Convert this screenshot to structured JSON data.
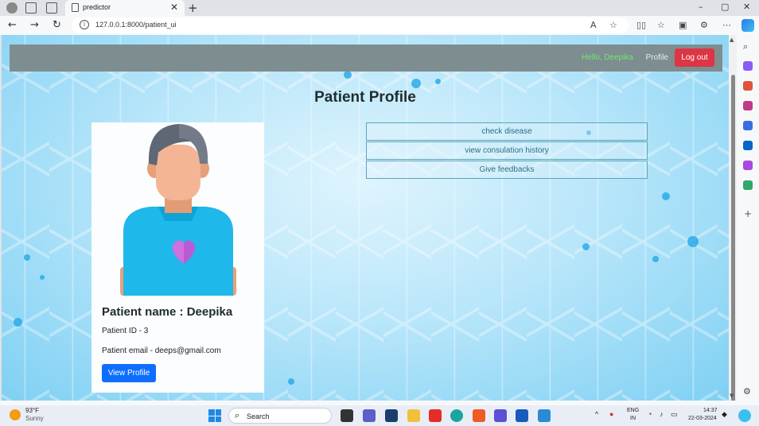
{
  "browser": {
    "tab_title": "predictor",
    "tab_close": "✕",
    "new_tab": "+",
    "url": "127.0.0.1:8000/patient_ui",
    "reader_icon_text": "A",
    "window_controls": [
      "–",
      "▢",
      "✕"
    ],
    "nav": {
      "back": "←",
      "forward": "→",
      "reload": "↻"
    },
    "toolbar_icons": [
      "split-screen-icon",
      "favorites-icon",
      "collections-icon",
      "extensions-icon",
      "more-icon"
    ],
    "more_glyph": "⋯"
  },
  "navbar": {
    "greeting": "Hello, Deepika",
    "profile_link": "Profile",
    "logout_label": "Log out",
    "greeting_color": "#6fe870",
    "logout_color": "#dc3545"
  },
  "page": {
    "title": "Patient Profile"
  },
  "patient_card": {
    "name_line": "Patient name : Deepika",
    "id_line": "Patient ID - 3",
    "email_line": "Patient email - deeps@gmail.com",
    "view_profile_label": "View Profile",
    "button_color": "#0d6efd"
  },
  "actions": [
    {
      "label": "check disease"
    },
    {
      "label": "view consulation history"
    },
    {
      "label": "Give feedbacks"
    }
  ],
  "taskbar": {
    "weather_temp": "93°F",
    "weather_desc": "Sunny",
    "search_label": "Search",
    "lang_top": "ENG",
    "lang_bottom": "IN",
    "time": "14:37",
    "date": "22-03-2024"
  }
}
